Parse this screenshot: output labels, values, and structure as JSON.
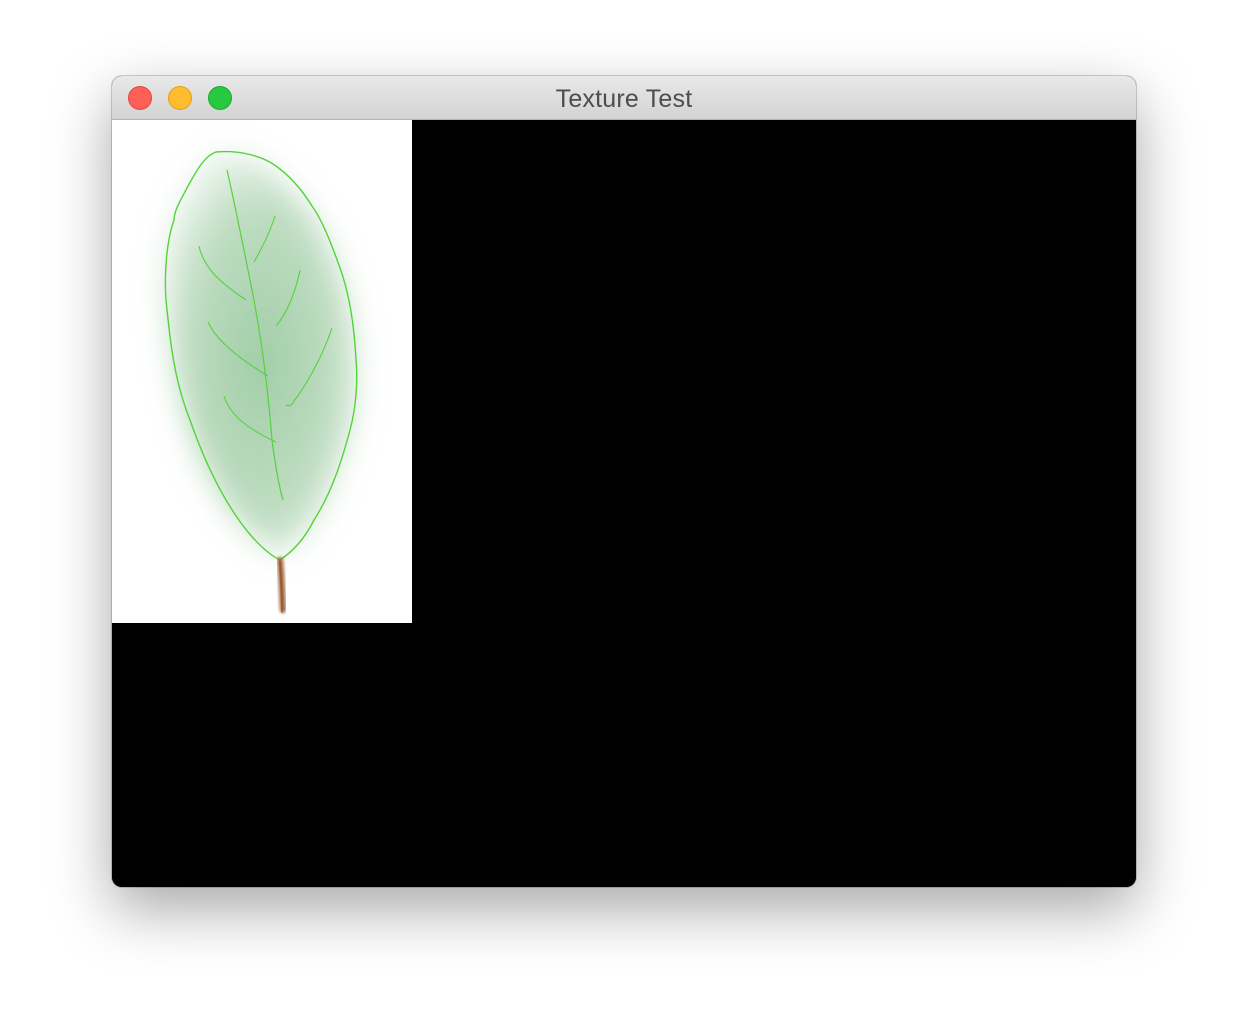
{
  "window": {
    "title": "Texture Test",
    "controls": {
      "close": "close-icon",
      "minimize": "minimize-icon",
      "zoom": "zoom-icon"
    },
    "colors": {
      "close": "#fe5f57",
      "minimize": "#febc2e",
      "zoom": "#28c840",
      "canvas_background": "#000000",
      "texture_background": "#ffffff"
    }
  },
  "texture": {
    "subject": "leaf-image",
    "colors": {
      "leaf_fill": "#a9d1ad",
      "leaf_outline": "#55d23c",
      "stem": "#a0653a"
    }
  }
}
